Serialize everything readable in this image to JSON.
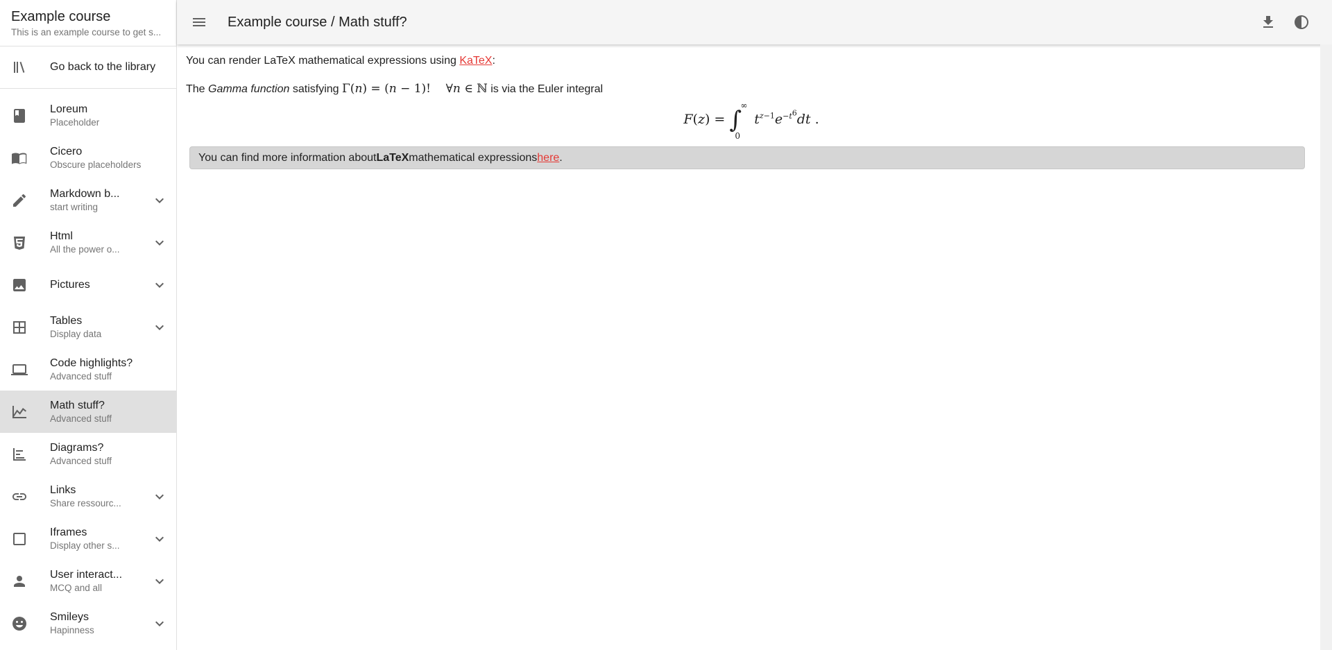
{
  "course": {
    "title": "Example course",
    "subtitle": "This is an example course to get s..."
  },
  "back": {
    "label": "Go back to the library",
    "icon": "library-icon"
  },
  "sidebar": {
    "items": [
      {
        "label": "Loreum",
        "sub": "Placeholder",
        "icon": "book-icon",
        "expandable": false
      },
      {
        "label": "Cicero",
        "sub": "Obscure placeholders",
        "icon": "open-book-icon",
        "expandable": false
      },
      {
        "label": "Markdown b...",
        "sub": "start writing",
        "icon": "pencil-icon",
        "expandable": true
      },
      {
        "label": "Html",
        "sub": "All the power o...",
        "icon": "html5-icon",
        "expandable": true
      },
      {
        "label": "Pictures",
        "sub": "",
        "icon": "image-icon",
        "expandable": true
      },
      {
        "label": "Tables",
        "sub": "Display data",
        "icon": "table-icon",
        "expandable": true
      },
      {
        "label": "Code highlights?",
        "sub": "Advanced stuff",
        "icon": "laptop-icon",
        "expandable": false
      },
      {
        "label": "Math stuff?",
        "sub": "Advanced stuff",
        "icon": "chart-line-icon",
        "expandable": false,
        "active": true
      },
      {
        "label": "Diagrams?",
        "sub": "Advanced stuff",
        "icon": "timeline-icon",
        "expandable": false
      },
      {
        "label": "Links",
        "sub": "Share ressourc...",
        "icon": "link-icon",
        "expandable": true
      },
      {
        "label": "Iframes",
        "sub": "Display other s...",
        "icon": "frame-icon",
        "expandable": true
      },
      {
        "label": "User interact...",
        "sub": "MCQ and all",
        "icon": "person-icon",
        "expandable": true
      },
      {
        "label": "Smileys",
        "sub": "Hapinness",
        "icon": "smiley-icon",
        "expandable": true
      }
    ]
  },
  "header": {
    "title": "Example course / Math stuff?"
  },
  "content": {
    "p1_before": "You can render LaTeX mathematical expressions using ",
    "p1_link": "KaTeX",
    "p1_after": ":",
    "p2_the": "The ",
    "p2_term": "Gamma function",
    "p2_satisfying": " satisfying ",
    "p2_after": " is via the Euler integral",
    "note_before": "You can find more information about ",
    "note_bold": "LaTeX",
    "note_middle": " mathematical expressions ",
    "note_link": "here",
    "note_after": "."
  },
  "colors": {
    "accent": "#e53935",
    "header_bg": "#f5f5f5",
    "active_bg": "#e0e0e0",
    "note_bg": "#d6d6d6"
  }
}
